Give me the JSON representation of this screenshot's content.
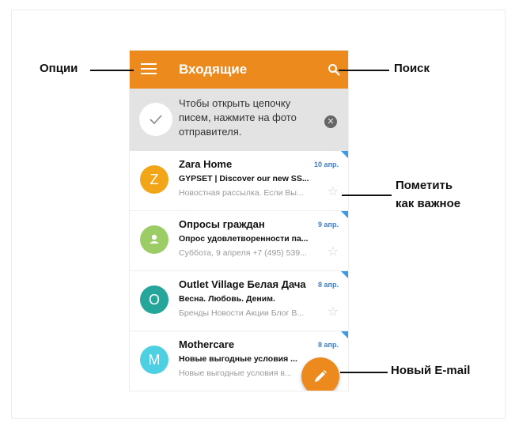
{
  "appbar": {
    "title": "Входящие"
  },
  "hint": {
    "text": "Чтобы открыть цепочку писем, нажмите на фото отправителя."
  },
  "emails": [
    {
      "avatar_letter": "Z",
      "avatar_color": "#f2a516",
      "sender": "Zara Home",
      "date": "10 апр.",
      "subject": "GYPSET | Discover our new SS...",
      "preview": "Новостная рассылка. Если Вы..."
    },
    {
      "avatar_letter": "",
      "avatar_color": "#9ccc65",
      "sender": "Опросы граждан",
      "date": "9 апр.",
      "subject": "Опрос удовлетворенности па...",
      "preview": "Суббота, 9 апреля +7 (495) 539..."
    },
    {
      "avatar_letter": "O",
      "avatar_color": "#26a69a",
      "sender": "Outlet Village Белая Дача",
      "date": "8 апр.",
      "subject": "Весна. Любовь. Деним.",
      "preview": "Бренды Новости Акции Блог В..."
    },
    {
      "avatar_letter": "M",
      "avatar_color": "#4dd0e1",
      "sender": "Mothercare",
      "date": "8 апр.",
      "subject": "Новые выгодные условия ...",
      "preview": "Новые выгодные условия в..."
    }
  ],
  "callouts": {
    "options": "Опции",
    "search": "Поиск",
    "mark_important_line1": "Пометить",
    "mark_important_line2": "как важное",
    "new_email": "Новый E-mail"
  },
  "colors": {
    "accent": "#ec8a1e",
    "date_blue": "#3a7fd0"
  }
}
